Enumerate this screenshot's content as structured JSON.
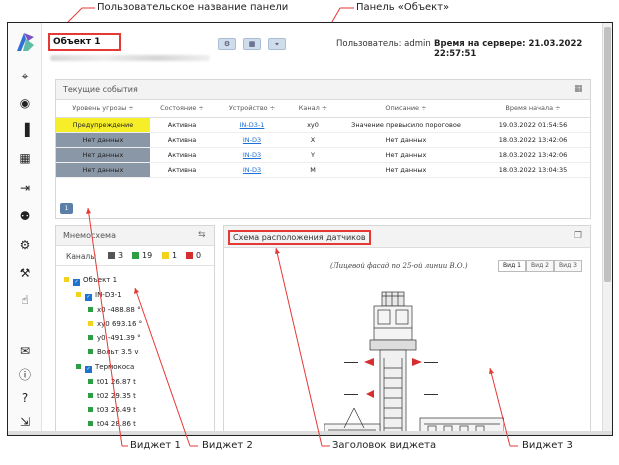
{
  "annotations": {
    "panel_name": "Пользовательское название панели",
    "object_panel": "Панель «Объект»",
    "widget1": "Виджет 1",
    "widget2": "Виджет 2",
    "widget_header": "Заголовок виджета",
    "widget3": "Виджет 3"
  },
  "header": {
    "panel_title": "Объект 1",
    "user_label": "Пользователь: admin",
    "server_time": "Время на сервере: 21.03.2022 22:57:51",
    "buttons": [
      {
        "icon": "gear-icon"
      },
      {
        "icon": "grid-icon"
      },
      {
        "icon": "pin-icon"
      }
    ]
  },
  "sidebar": {
    "items": [
      "location-pin-icon",
      "eye-icon",
      "bar-chart-icon",
      "calendar-icon",
      "export-icon",
      "users-icon",
      "settings-icon",
      "config-icon",
      "thumbs-up-icon",
      "mail-icon",
      "info-icon",
      "help-icon",
      "logout-icon"
    ]
  },
  "events": {
    "title": "Текущие события",
    "columns": [
      "Уровень угрозы ÷",
      "Состояние ÷",
      "Устройство ÷",
      "Канал ÷",
      "Описание ÷",
      "Время начала ÷"
    ],
    "rows": [
      {
        "level": "Предупреждение",
        "state": "Активна",
        "device": "IN-D3-1",
        "channel": "xy0",
        "desc": "Значение превысило пороговое",
        "time": "19.03.2022 01:54:56",
        "sev": "warn"
      },
      {
        "level": "Нет данных",
        "state": "Активна",
        "device": "IN-D3",
        "channel": "X",
        "desc": "Нет данных",
        "time": "18.03.2022 13:42:06",
        "sev": "none"
      },
      {
        "level": "Нет данных",
        "state": "Активна",
        "device": "IN-D3",
        "channel": "Y",
        "desc": "Нет данных",
        "time": "18.03.2022 13:42:06",
        "sev": "none"
      },
      {
        "level": "Нет данных",
        "state": "Активна",
        "device": "IN-D3",
        "channel": "M",
        "desc": "Нет данных",
        "time": "18.03.2022 13:04:35",
        "sev": "none"
      }
    ],
    "page": "1"
  },
  "mnemo": {
    "title": "Мнемосхема",
    "channels_label": "Каналы",
    "counts": [
      {
        "color": "#555555",
        "value": "3"
      },
      {
        "color": "#2e9e44",
        "value": "19"
      },
      {
        "color": "#f2d21b",
        "value": "1"
      },
      {
        "color": "#d62f2f",
        "value": "0"
      }
    ],
    "tree": [
      {
        "label": "Объект 1",
        "level": 0,
        "type": "obj"
      },
      {
        "label": "IN-D3-1",
        "level": 1,
        "type": "dev"
      },
      {
        "label": "x0   -488.88 °",
        "level": 2,
        "type": "green"
      },
      {
        "label": "xy0   693.16 °",
        "level": 2,
        "type": "yellow"
      },
      {
        "label": "y0   -491.39 °",
        "level": 2,
        "type": "green"
      },
      {
        "label": "Вольт   3.5 v",
        "level": 2,
        "type": "green"
      },
      {
        "label": "Термокоса",
        "level": 1,
        "type": "dev"
      },
      {
        "label": "t01   26.87 t",
        "level": 2,
        "type": "green"
      },
      {
        "label": "t02   29.35 t",
        "level": 2,
        "type": "green"
      },
      {
        "label": "t03   26.49 t",
        "level": 2,
        "type": "green"
      },
      {
        "label": "t04   28.86 t",
        "level": 2,
        "type": "green"
      }
    ]
  },
  "scheme": {
    "title": "Схема расположения датчиков",
    "facade": "(Лицевой фасад по 25-ой линии В.О.)",
    "views": [
      "Вид 1",
      "Вид 2",
      "Вид 3"
    ]
  }
}
